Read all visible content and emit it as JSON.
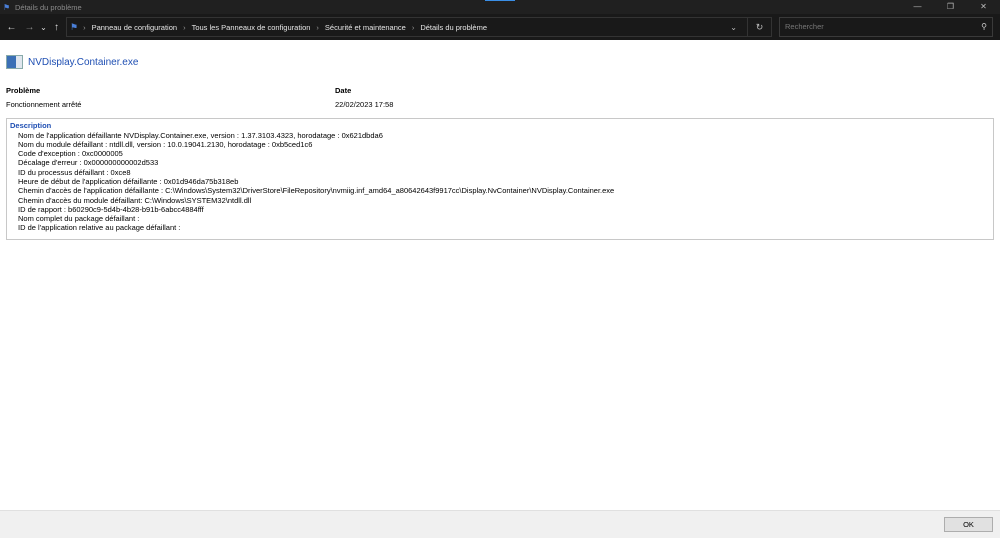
{
  "window": {
    "title": "Détails du problème",
    "minimize": "—",
    "maximize": "❐",
    "close": "✕"
  },
  "nav": {
    "back": "←",
    "forward": "→",
    "recent": "⌄",
    "up": "↑",
    "breadcrumb": [
      "Panneau de configuration",
      "Tous les Panneaux de configuration",
      "Sécurité et maintenance",
      "Détails du problème"
    ],
    "search_placeholder": "Rechercher"
  },
  "app": {
    "name": "NVDisplay.Container.exe"
  },
  "summary": {
    "problem_label": "Problème",
    "problem_value": "Fonctionnement arrêté",
    "date_label": "Date",
    "date_value": "22/02/2023 17:58"
  },
  "description": {
    "heading": "Description",
    "lines": [
      "Nom de l'application défaillante NVDisplay.Container.exe, version : 1.37.3103.4323, horodatage : 0x621dbda6",
      "Nom du module défaillant : ntdll.dll, version : 10.0.19041.2130, horodatage : 0xb5ced1c6",
      "Code d'exception : 0xc0000005",
      "Décalage d'erreur : 0x000000000002d533",
      "ID du processus défaillant : 0xce8",
      "Heure de début de l'application défaillante : 0x01d946da75b318eb",
      "Chemin d'accès de l'application défaillante : C:\\Windows\\System32\\DriverStore\\FileRepository\\nvmiig.inf_amd64_a80642643f9917cc\\Display.NvContainer\\NVDisplay.Container.exe",
      "Chemin d'accès du module défaillant: C:\\Windows\\SYSTEM32\\ntdll.dll",
      "ID de rapport : b60290c9-5d4b-4b28-b91b-6abcc4884fff",
      "Nom complet du package défaillant :",
      "ID de l'application relative au package défaillant :"
    ]
  },
  "footer": {
    "ok_label": "OK"
  }
}
